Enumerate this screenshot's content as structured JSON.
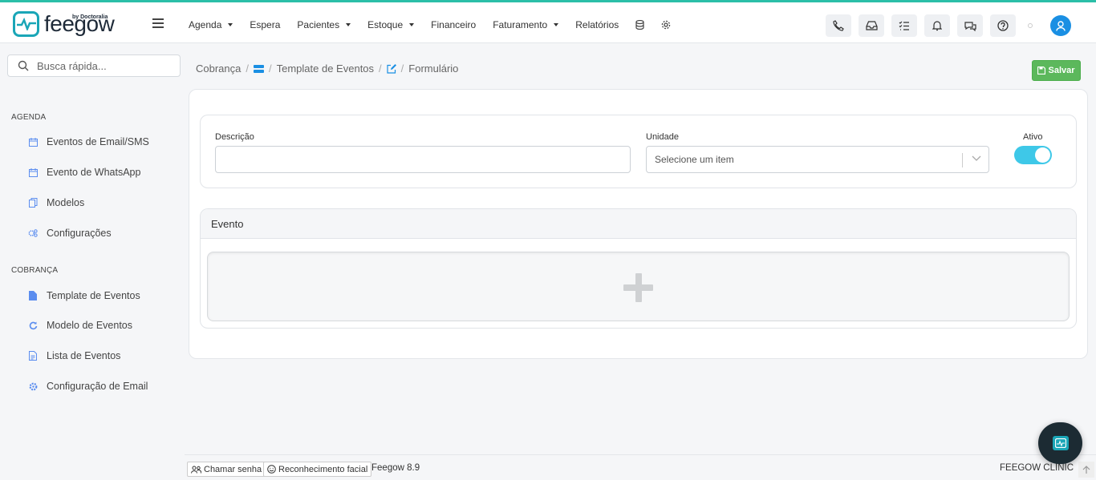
{
  "app": {
    "logo_text": "feegow",
    "logo_sub": "by Doctoralia"
  },
  "nav": {
    "items": [
      {
        "label": "Agenda",
        "dropdown": true
      },
      {
        "label": "Espera",
        "dropdown": false
      },
      {
        "label": "Pacientes",
        "dropdown": true
      },
      {
        "label": "Estoque",
        "dropdown": true
      },
      {
        "label": "Financeiro",
        "dropdown": false
      },
      {
        "label": "Faturamento",
        "dropdown": true
      },
      {
        "label": "Relatórios",
        "dropdown": false
      }
    ],
    "icons": [
      "database-icon",
      "gear-icon"
    ]
  },
  "toolbar": {
    "icons": [
      "phone-icon",
      "inbox-icon",
      "checklist-icon",
      "bell-icon",
      "chat-icon",
      "help-icon"
    ]
  },
  "sidebar": {
    "search_placeholder": "Busca rápida...",
    "sections": [
      {
        "title": "AGENDA",
        "items": [
          {
            "label": "Eventos de Email/SMS",
            "icon": "calendar-icon"
          },
          {
            "label": "Evento de WhatsApp",
            "icon": "calendar-icon"
          },
          {
            "label": "Modelos",
            "icon": "copy-icon"
          },
          {
            "label": "Configurações",
            "icon": "cogs-icon"
          }
        ]
      },
      {
        "title": "COBRANÇA",
        "items": [
          {
            "label": "Template de Eventos",
            "icon": "file-icon"
          },
          {
            "label": "Modelo de Eventos",
            "icon": "refresh-icon"
          },
          {
            "label": "Lista de Eventos",
            "icon": "file-text-icon"
          },
          {
            "label": "Configuração de Email",
            "icon": "gear-icon"
          }
        ]
      }
    ]
  },
  "breadcrumb": {
    "items": [
      "Cobrança",
      "Template de Eventos",
      "Formulário"
    ]
  },
  "save_button": {
    "label": "Salvar"
  },
  "form": {
    "descricao_label": "Descrição",
    "descricao_value": "",
    "unidade_label": "Unidade",
    "unidade_placeholder": "Selecione um item",
    "ativo_label": "Ativo",
    "ativo_value": true
  },
  "evento": {
    "title": "Evento"
  },
  "footer": {
    "chamar_senha": "Chamar senha",
    "reconhecimento": "Reconhecimento facial",
    "version": "Feegow 8.9",
    "clinic": "FEEGOW CLINIC"
  },
  "colors": {
    "accent": "#1aa6b7",
    "save": "#5cb85c",
    "toggle": "#3ec8e8",
    "avatar": "#1a8fe3"
  }
}
